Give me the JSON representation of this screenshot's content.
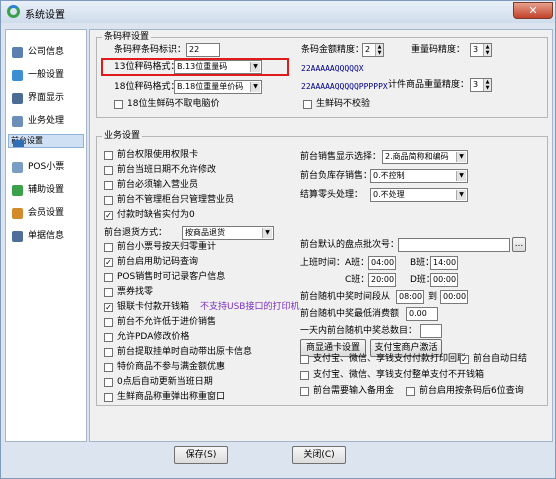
{
  "window": {
    "title": "系统设置",
    "close": "✕"
  },
  "sidebar": {
    "items": [
      {
        "label": "公司信息",
        "icon_color": "#5a7fb0",
        "selected": false
      },
      {
        "label": "一般设置",
        "icon_color": "#3b8fd0",
        "selected": false
      },
      {
        "label": "界面显示",
        "icon_color": "#4a6c95",
        "selected": false
      },
      {
        "label": "业务处理",
        "icon_color": "#6b8fb8",
        "selected": false
      },
      {
        "label": "前台设置",
        "icon_color": "#2f6fb5",
        "selected": true
      },
      {
        "label": "POS小票",
        "icon_color": "#7a9dc4",
        "selected": false
      },
      {
        "label": "辅助设置",
        "icon_color": "#3aa04a",
        "selected": false
      },
      {
        "label": "会员设置",
        "icon_color": "#d28a2a",
        "selected": false
      },
      {
        "label": "单据信息",
        "icon_color": "#4e6f9a",
        "selected": false
      }
    ]
  },
  "barcode": {
    "group": "条码秤设置",
    "flag_label": "条码秤条码标识：",
    "flag_value": "22",
    "f13_label": "13位秤码格式：",
    "f13_value": "B.13位重量码",
    "f18_label": "18位秤码格式：",
    "f18_value": "B.18位重量单价码",
    "cb_noprice": "18位生鲜码不取电脑价",
    "amount_label": "条码金额精度：",
    "amount_value": "2",
    "weight_label": "重量码精度：",
    "weight_value": "3",
    "code13": "22AAAAAQQQQQX",
    "code18": "22AAAAAQQQQQPPPPPX",
    "unit_label": "计件商品重量精度：",
    "unit_value": "3",
    "cb_nocheck": "生鲜码不校验"
  },
  "business": {
    "group": "业务设置",
    "left_checks": [
      {
        "label": "前台权限使用权限卡",
        "checked": false
      },
      {
        "label": "前台当班日期不允许修改",
        "checked": false
      },
      {
        "label": "前台必须输入营业员",
        "checked": false
      },
      {
        "label": "前台不管理柜台只管理营业员",
        "checked": false
      },
      {
        "label": "付款时缺省实付为0",
        "checked": true
      }
    ],
    "return_label": "前台退货方式：",
    "return_value": "按商品退货",
    "left_checks2": [
      {
        "label": "前台小票号按天归零重计",
        "checked": false
      },
      {
        "label": "前台启用助记码查询",
        "checked": true
      },
      {
        "label": "POS销售时可记录客户信息",
        "checked": false
      },
      {
        "label": "票券找零",
        "checked": false
      },
      {
        "label": "银联卡付款开钱箱",
        "checked": true,
        "note": "不支持USB接口的打印机"
      },
      {
        "label": "前台不允许低于进价销售",
        "checked": false
      },
      {
        "label": "允许PDA修改价格",
        "checked": false
      },
      {
        "label": "前台提取挂单时自动带出原卡信息",
        "checked": false
      },
      {
        "label": "特价商品不参与满金额优惠",
        "checked": false
      },
      {
        "label": "0点后自动更新当班日期",
        "checked": false
      },
      {
        "label": "生鲜商品称重弹出称重窗口",
        "checked": false
      }
    ],
    "sales_display_label": "前台销售显示选择：",
    "sales_display_value": "2.商品简称和编码",
    "stock_label": "前台负库存销售：",
    "stock_value": "0.不控制",
    "change_label": "结算零头处理：",
    "change_value": "0.不处理",
    "inventory_label": "前台默认的盘点批次号：",
    "inventory_value": "",
    "inventory_btn": "...",
    "shift_label": "上班时间：",
    "a_label": "A班：",
    "a_value": "04:00",
    "b_label": "B班：",
    "b_value": "14:00",
    "c_label": "C班：",
    "c_value": "20:00",
    "d_label": "D班：",
    "d_value": "00:00",
    "lottery_label": "前台随机中奖时间段从",
    "lottery_from": "08:00",
    "lottery_to_label": "到",
    "lottery_to": "00:00",
    "min_amount_label": "前台随机中奖最低消费额",
    "min_amount_value": "0.00",
    "max_count_label": "一天内前台随机中奖总数目：",
    "max_count_value": "",
    "btn_notice": "商显通卡设置",
    "btn_pay": "支付宝商户激活",
    "bottom_checks": [
      {
        "label": "支付宝、微信、享钱支付付款打印回联",
        "checked": false
      },
      {
        "label": "前台自动日结",
        "checked": true
      },
      {
        "label": "支付宝、微信、享钱支付整单支付不开钱箱",
        "checked": false
      },
      {
        "label": "前台需要输入备用金",
        "checked": false
      },
      {
        "label": "前台启用按条码后6位查询",
        "checked": false
      }
    ]
  },
  "footer": {
    "save": "保存(S)",
    "close": "关闭(C)"
  }
}
